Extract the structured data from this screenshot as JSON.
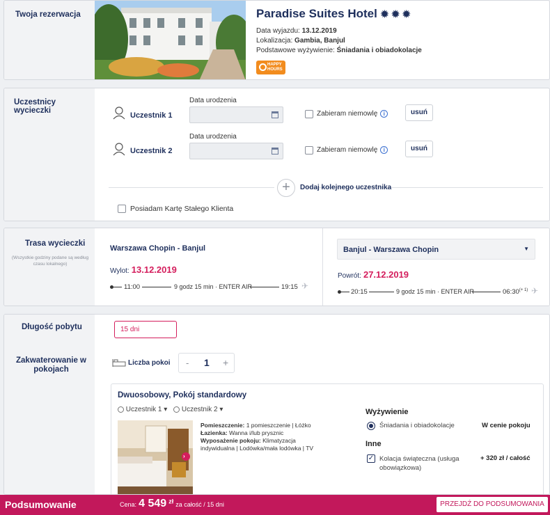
{
  "reservation": {
    "section_label": "Twoja rezerwacja",
    "hotel_name": "Paradise Suites Hotel",
    "stars": "✹ ✹ ✹",
    "departure_label": "Data wyjazdu:",
    "departure_value": "13.12.2019",
    "location_label": "Lokalizacja:",
    "location_value": "Gambia, Banjul",
    "board_label": "Podstawowe wyżywienie:",
    "board_value": "Śniadania i obiadokolacje",
    "badge_line1": "HAPPY",
    "badge_line2": "HOURS"
  },
  "participants": {
    "section_label": "Uczestnicy wycieczki",
    "rows": [
      {
        "name": "Uczestnik 1",
        "dob_label": "Data urodzenia",
        "infant_label": "Zabieram niemowlę",
        "remove_label": "usuń"
      },
      {
        "name": "Uczestnik 2",
        "dob_label": "Data urodzenia",
        "infant_label": "Zabieram niemowlę",
        "remove_label": "usuń"
      }
    ],
    "add_label": "Dodaj kolejnego uczestnika",
    "loyalty_label": "Posiadam Kartę Stałego Klienta"
  },
  "route": {
    "section_label": "Trasa wycieczki",
    "section_note": "(Wszystkie godziny podane są według czasu lokalnego)",
    "outbound": {
      "title": "Warszawa Chopin - Banjul",
      "date_label": "Wylot:",
      "date": "13.12.2019",
      "dep_time": "11:00",
      "info": "9 godz 15 min · ENTER AIR",
      "arr_time": "19:15"
    },
    "return": {
      "selected": "Banjul - Warszawa Chopin",
      "date_label": "Powrót:",
      "date": "27.12.2019",
      "dep_time": "20:15",
      "info": "9 godz 15 min · ENTER AIR",
      "arr_time": "06:30",
      "arr_suffix": "(+ 1)"
    }
  },
  "stay": {
    "length_label": "Długość pobytu",
    "length_value": "15 dni",
    "rooms_section_label": "Zakwaterowanie w pokojach",
    "rooms_count_label": "Liczba pokoi",
    "minus": "-",
    "rooms_count": "1",
    "plus": "+"
  },
  "room": {
    "title": "Dwuosobowy, Pokój standardowy",
    "guest1": "Uczestnik 1",
    "guest2": "Uczestnik 2",
    "room_label": "Pomieszczenie:",
    "room_value": "1 pomieszczenie | Łóżko",
    "bath_label": "Łazienka:",
    "bath_value": "Wanna i/lub prysznic",
    "equip_label": "Wyposażenie pokoju:",
    "equip_value": "Klimatyzacja indywidualna | Lodówka/mała lodówka | TV",
    "board_heading": "Wyżywienie",
    "board_option": "Śniadania i obiadokolacje",
    "board_price": "W cenie pokoju",
    "other_heading": "Inne",
    "other_option": "Kolacja świąteczna (usługa obowiązkowa)",
    "other_price": "+ 320 zł / całość"
  },
  "summary": {
    "label": "Podsumowanie",
    "price_prefix": "Cena:",
    "price_value": "4 549",
    "currency": "zł",
    "price_suffix": "za całość / 15 dni",
    "cta": "PRZEJDŹ DO PODSUMOWANIA"
  },
  "colors": {
    "accent": "#c2185b",
    "navy": "#1e2f5c",
    "badge": "#f28c1e"
  }
}
